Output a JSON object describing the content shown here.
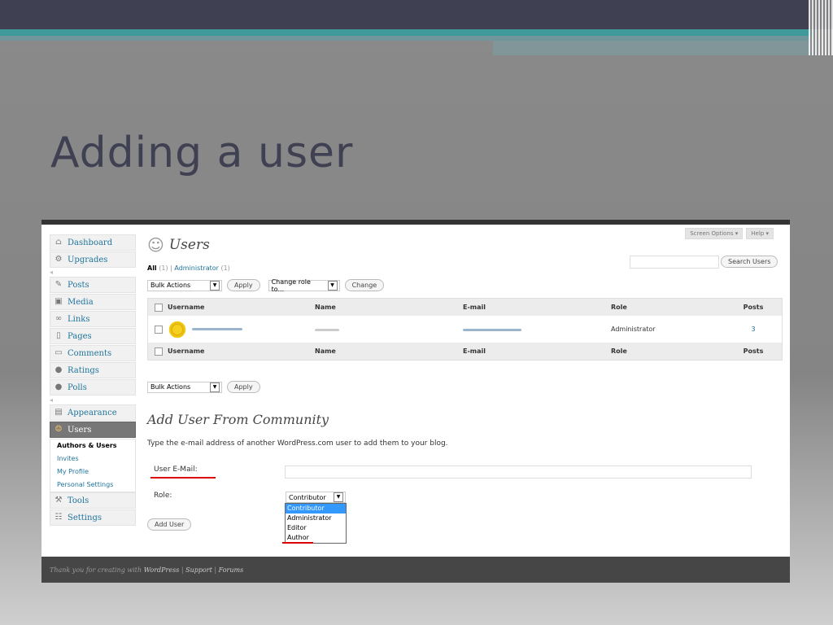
{
  "slide": {
    "title": "Adding a user"
  },
  "menu": {
    "items_top": [
      {
        "label": "Dashboard",
        "icon": "home-icon"
      },
      {
        "label": "Upgrades",
        "icon": "gear-icon"
      }
    ],
    "items_mid": [
      {
        "label": "Posts",
        "icon": "pin-icon"
      },
      {
        "label": "Media",
        "icon": "media-icon"
      },
      {
        "label": "Links",
        "icon": "link-icon"
      },
      {
        "label": "Pages",
        "icon": "pages-icon"
      },
      {
        "label": "Comments",
        "icon": "comment-icon"
      },
      {
        "label": "Ratings",
        "icon": "circle-icon"
      },
      {
        "label": "Polls",
        "icon": "circle-icon"
      }
    ],
    "appearance": "Appearance",
    "users": "Users",
    "users_sub": [
      "Authors & Users",
      "Invites",
      "My Profile",
      "Personal Settings"
    ],
    "tools": "Tools",
    "settings": "Settings"
  },
  "header": {
    "title": "Users",
    "screen_options": "Screen Options",
    "help": "Help",
    "search_button": "Search Users"
  },
  "filters": {
    "all": "All",
    "all_count": "(1)",
    "sep": "|",
    "admin": "Administrator",
    "admin_count": "(1)"
  },
  "bulk": {
    "actions": "Bulk Actions",
    "apply": "Apply",
    "change_role": "Change role to...",
    "change": "Change"
  },
  "table": {
    "headers": [
      "Username",
      "Name",
      "E-mail",
      "Role",
      "Posts"
    ],
    "row": {
      "role": "Administrator",
      "posts": "3"
    }
  },
  "add_user": {
    "heading": "Add User From Community",
    "description": "Type the e-mail address of another WordPress.com user to add them to your blog.",
    "email_label": "User E-Mail:",
    "role_label": "Role:",
    "role_selected": "Contributor",
    "role_options": [
      "Contributor",
      "Administrator",
      "Editor",
      "Author"
    ],
    "button": "Add User"
  },
  "footer": {
    "thanks": "Thank you for creating with",
    "wp": "WordPress",
    "support": "Support",
    "forums": "Forums",
    "sep": "|"
  },
  "colors": {
    "link": "#21759b",
    "slide_title": "#3f4052",
    "highlight": "#3399ff",
    "underline": "#dd0000"
  }
}
